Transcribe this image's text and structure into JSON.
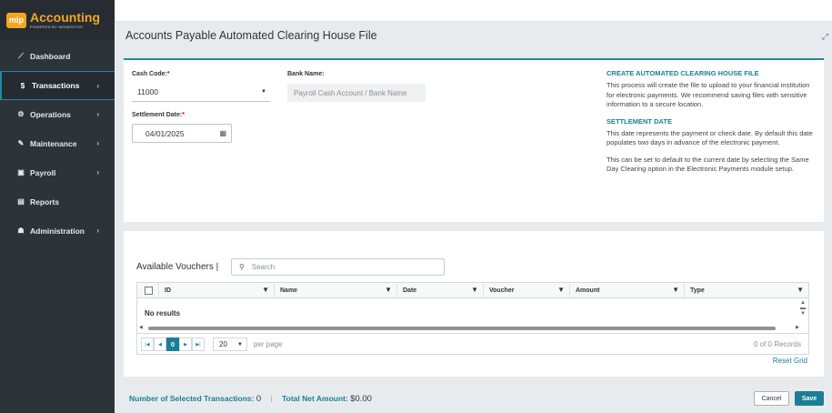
{
  "brand": {
    "badge": "mip",
    "title": "Accounting",
    "subtitle": "POWERED BY MOMENTIVE"
  },
  "sidebar": {
    "items": [
      {
        "label": "Dashboard",
        "icon": "chart-line-icon",
        "glyph": "⟋",
        "chevron": ""
      },
      {
        "label": "Transactions",
        "icon": "dollar-icon",
        "glyph": "$",
        "chevron": "›"
      },
      {
        "label": "Operations",
        "icon": "gears-icon",
        "glyph": "⚙",
        "chevron": "›"
      },
      {
        "label": "Maintenance",
        "icon": "wrench-icon",
        "glyph": "✎",
        "chevron": "›"
      },
      {
        "label": "Payroll",
        "icon": "money-bill-icon",
        "glyph": "▣",
        "chevron": "›"
      },
      {
        "label": "Reports",
        "icon": "file-icon",
        "glyph": "▤",
        "chevron": ""
      },
      {
        "label": "Administration",
        "icon": "users-icon",
        "glyph": "☗",
        "chevron": "›"
      }
    ]
  },
  "page": {
    "title": "Accounts Payable Automated Clearing House File"
  },
  "form": {
    "cash_code_label": "Cash Code:",
    "cash_code_value": "11000",
    "bank_name_label": "Bank Name:",
    "bank_name_placeholder": "Payroll Cash Account / Bank Name",
    "settlement_date_label": "Settlement Date:",
    "settlement_date_value": "04/01/2025",
    "required_mark": "*"
  },
  "info": {
    "heading1": "CREATE AUTOMATED CLEARING HOUSE FILE",
    "para1": "This process will create the file to upload to your financial institution for electronic payments. We recommend saving files with sensitive information to a secure location.",
    "heading2": "SETTLEMENT DATE",
    "para2": "This date represents the payment or check date. By default this date populates two days in advance of the electronic payment.",
    "para3": "This can be set to default to the current date by selecting the Same Day Clearing option in the Electronic Payments module setup."
  },
  "vouchers": {
    "title": "Available Vouchers |",
    "search_placeholder": "Search",
    "columns": [
      "ID",
      "Name",
      "Date",
      "Voucher",
      "Amount",
      "Type"
    ],
    "empty_text": "No results",
    "pager": {
      "current_page": "0",
      "page_size": "20",
      "per_page_label": "per page",
      "records": "0 of 0 Records"
    },
    "reset_label": "Reset Grid"
  },
  "footer": {
    "selected_label": "Number of Selected Transactions:",
    "selected_value": "0",
    "separator": "|",
    "net_label": "Total Net Amount:",
    "net_value": "$0.00",
    "cancel_label": "Cancel",
    "save_label": "Save"
  }
}
